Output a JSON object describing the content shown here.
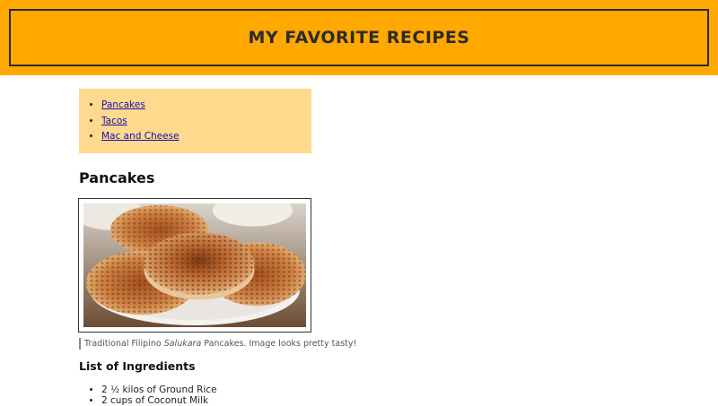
{
  "header": {
    "title": "MY FAVORITE RECIPES"
  },
  "toc": {
    "links": [
      {
        "label": "Pancakes"
      },
      {
        "label": "Tacos"
      },
      {
        "label": "Mac and Cheese"
      }
    ]
  },
  "recipe": {
    "title": "Pancakes",
    "caption": {
      "before": "Traditional Filipino ",
      "emphasis": "Salukara",
      "after": " Pancakes. Image looks pretty tasty!"
    },
    "ingredients_title": "List of Ingredients",
    "ingredients": [
      "2 ½ kilos of Ground Rice",
      "2 cups of Coconut Milk"
    ]
  },
  "colors": {
    "banner_background": "#ffa800",
    "toc_background": "#ffd98e",
    "link": "#1a0dab"
  }
}
